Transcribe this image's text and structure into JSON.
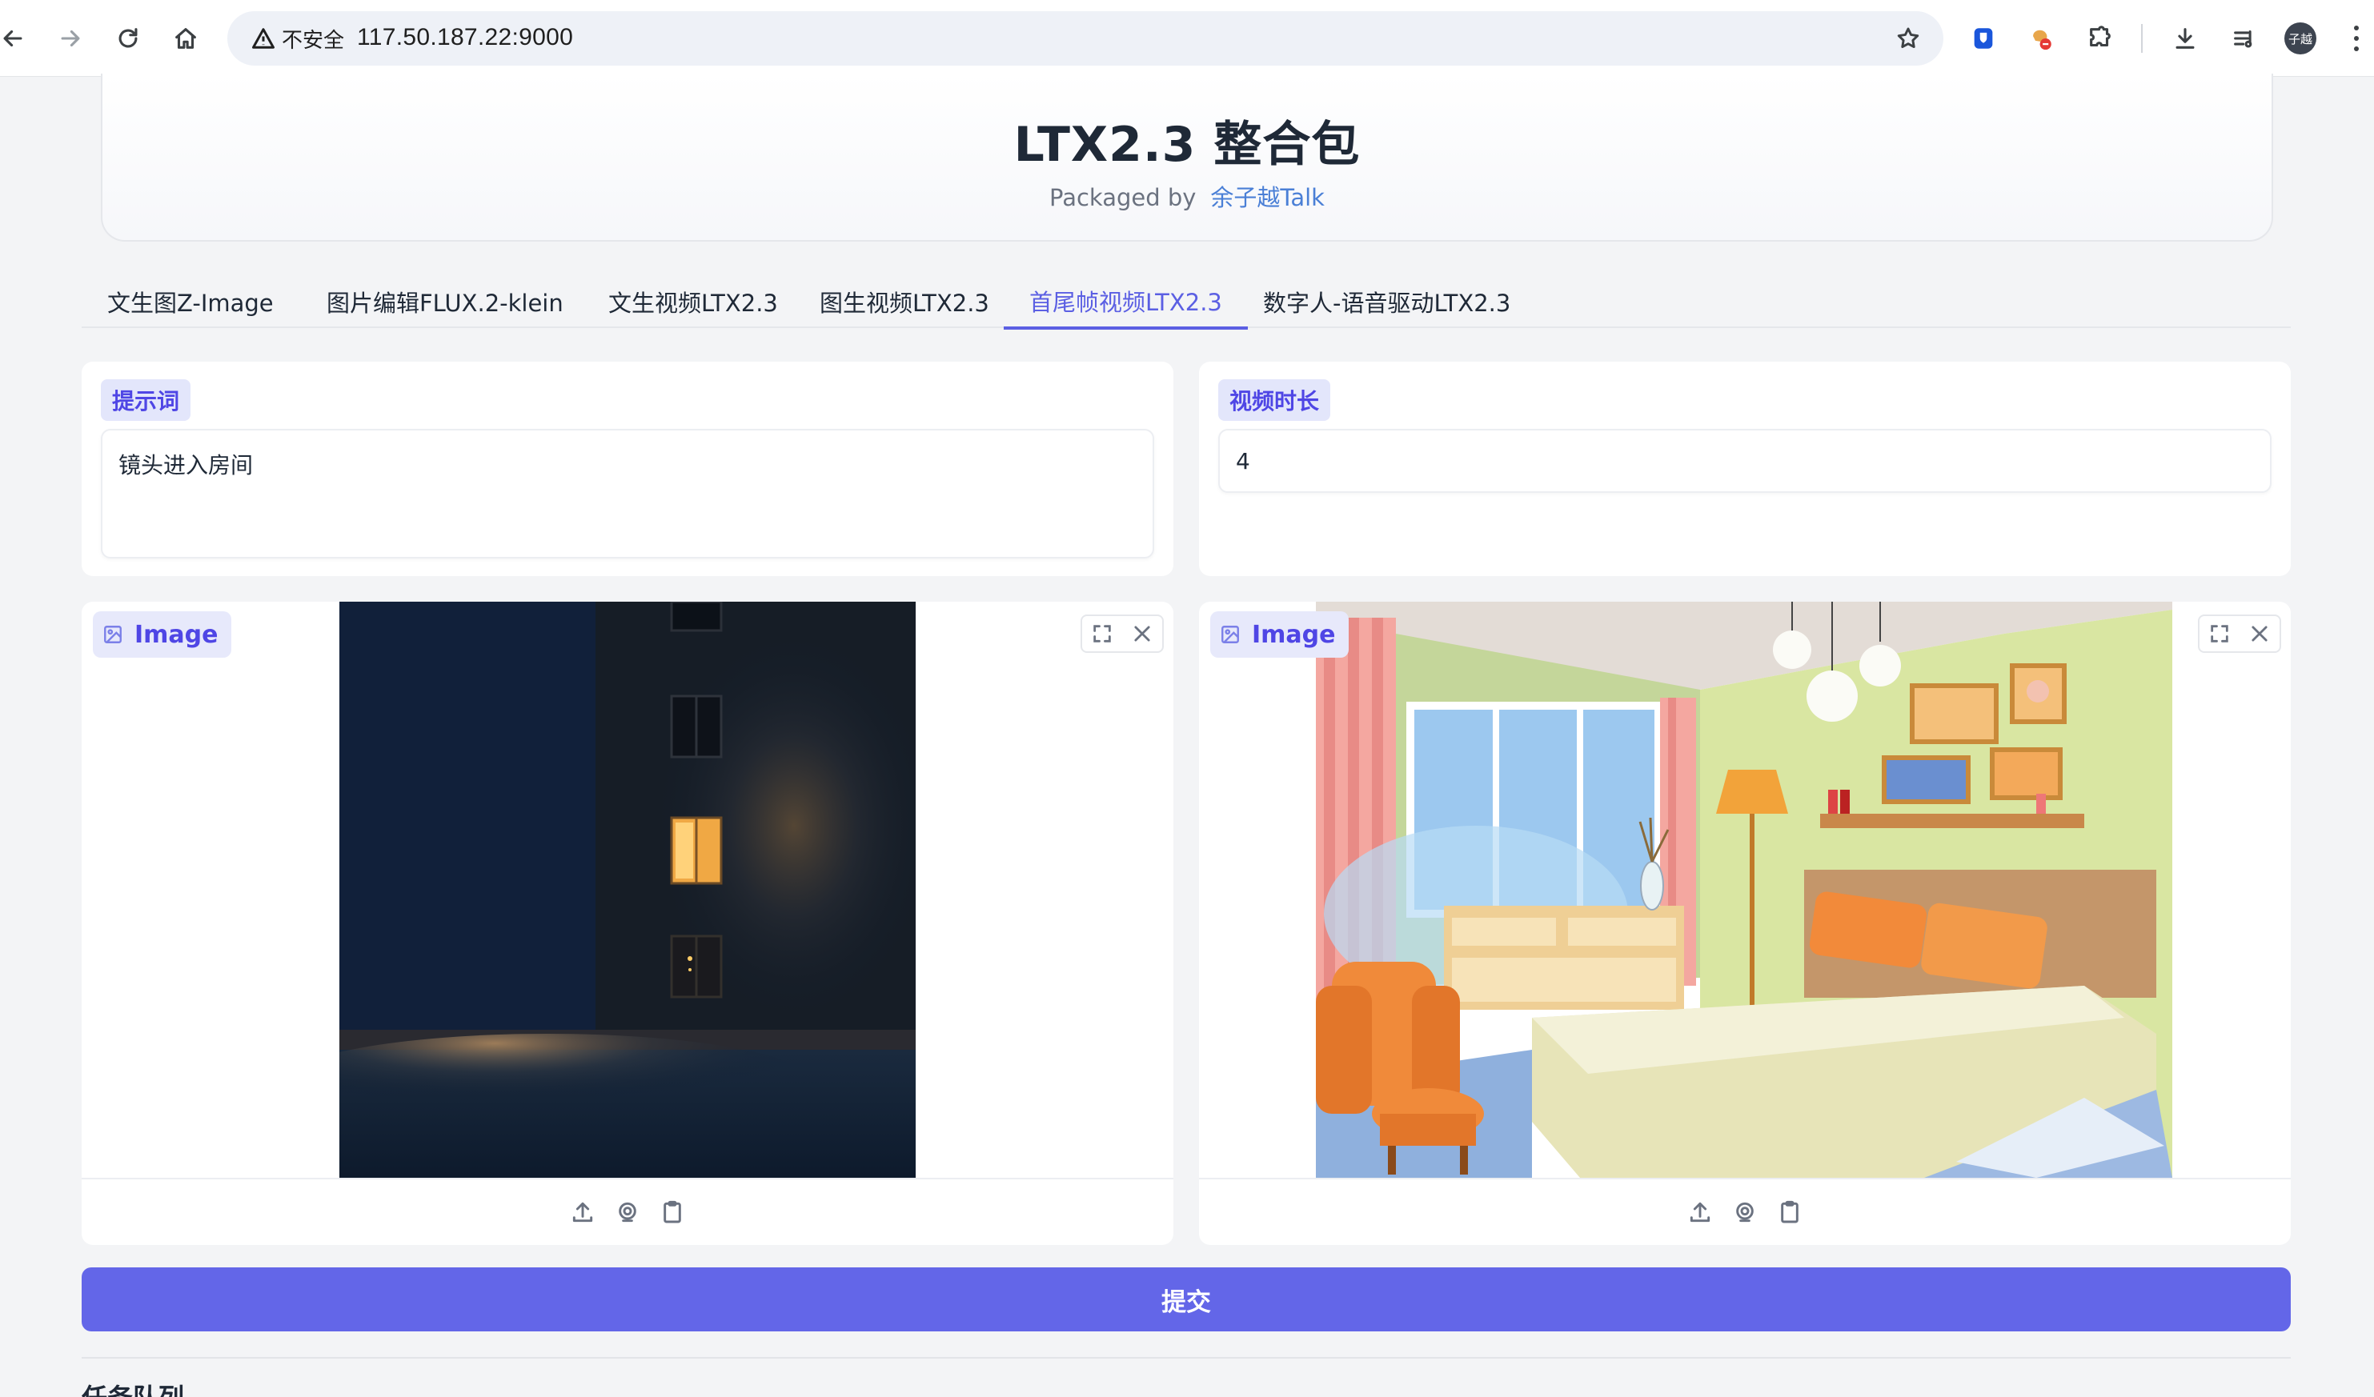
{
  "browser": {
    "security_label": "不安全",
    "url": "117.50.187.22:9000",
    "avatar_text": "子越"
  },
  "header": {
    "title": "LTX2.3 整合包",
    "packaged_by": "Packaged by",
    "author": "余子越Talk"
  },
  "tabs": [
    {
      "label": "文生图Z-Image"
    },
    {
      "label": "图片编辑FLUX.2-klein"
    },
    {
      "label": "文生视频LTX2.3"
    },
    {
      "label": "图生视频LTX2.3"
    },
    {
      "label": "首尾帧视频LTX2.3",
      "active": true
    },
    {
      "label": "数字人-语音驱动LTX2.3"
    }
  ],
  "prompt": {
    "label": "提示词",
    "value": "镜头进入房间"
  },
  "duration": {
    "label": "视频时长",
    "value": "4"
  },
  "first_frame": {
    "label": "Image"
  },
  "last_frame": {
    "label": "Image"
  },
  "submit_label": "提交",
  "queue_title": "任务队列",
  "colors": {
    "accent": "#6366e8",
    "tab_active": "#5b5fe3",
    "author_link": "#4a7fd6"
  }
}
